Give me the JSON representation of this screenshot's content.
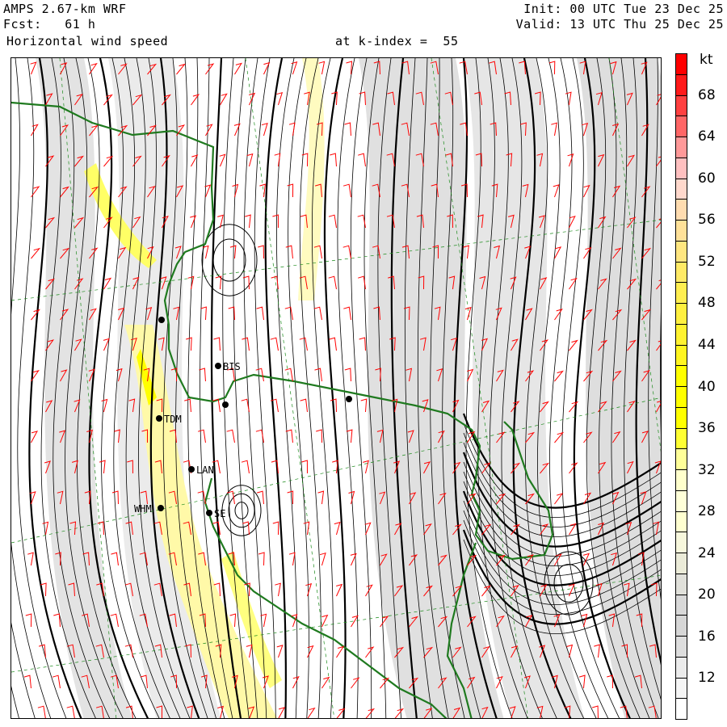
{
  "header": {
    "model": "AMPS 2.67-km WRF",
    "forecast": "Fcst:   61 h",
    "init": "Init: 00 UTC Tue 23 Dec 25",
    "valid": "Valid: 13 UTC Thu 25 Dec 25",
    "field": "Horizontal wind speed",
    "level": "at k-index =  55"
  },
  "colorbar": {
    "unit": "kt",
    "labels": [
      "68",
      "64",
      "60",
      "56",
      "52",
      "48",
      "44",
      "40",
      "36",
      "32",
      "28",
      "24",
      "20",
      "16",
      "12"
    ],
    "colors": [
      "#ff0000",
      "#ff1a1a",
      "#ff4040",
      "#ff6666",
      "#ff9999",
      "#ffc0c0",
      "#ffd8cc",
      "#ffdcb0",
      "#ffe199",
      "#ffe680",
      "#ffea66",
      "#ffee50",
      "#fff040",
      "#fff230",
      "#fff520",
      "#ffff00",
      "#ffff00",
      "#ffff00",
      "#ffff33",
      "#ffff99",
      "#ffffcc",
      "#ffffd8",
      "#ffffd0",
      "#f7f7dc",
      "#ebebd8",
      "#e0e0da",
      "#d8d8d8",
      "#d6d6d6",
      "#dddddd",
      "#ebebeb",
      "#f5f5f5",
      "#ffffff"
    ]
  },
  "stations": [
    {
      "id": "BIS"
    },
    {
      "id": "TDM"
    },
    {
      "id": "LAN"
    },
    {
      "id": "WHM"
    },
    {
      "id": "SE"
    }
  ]
}
